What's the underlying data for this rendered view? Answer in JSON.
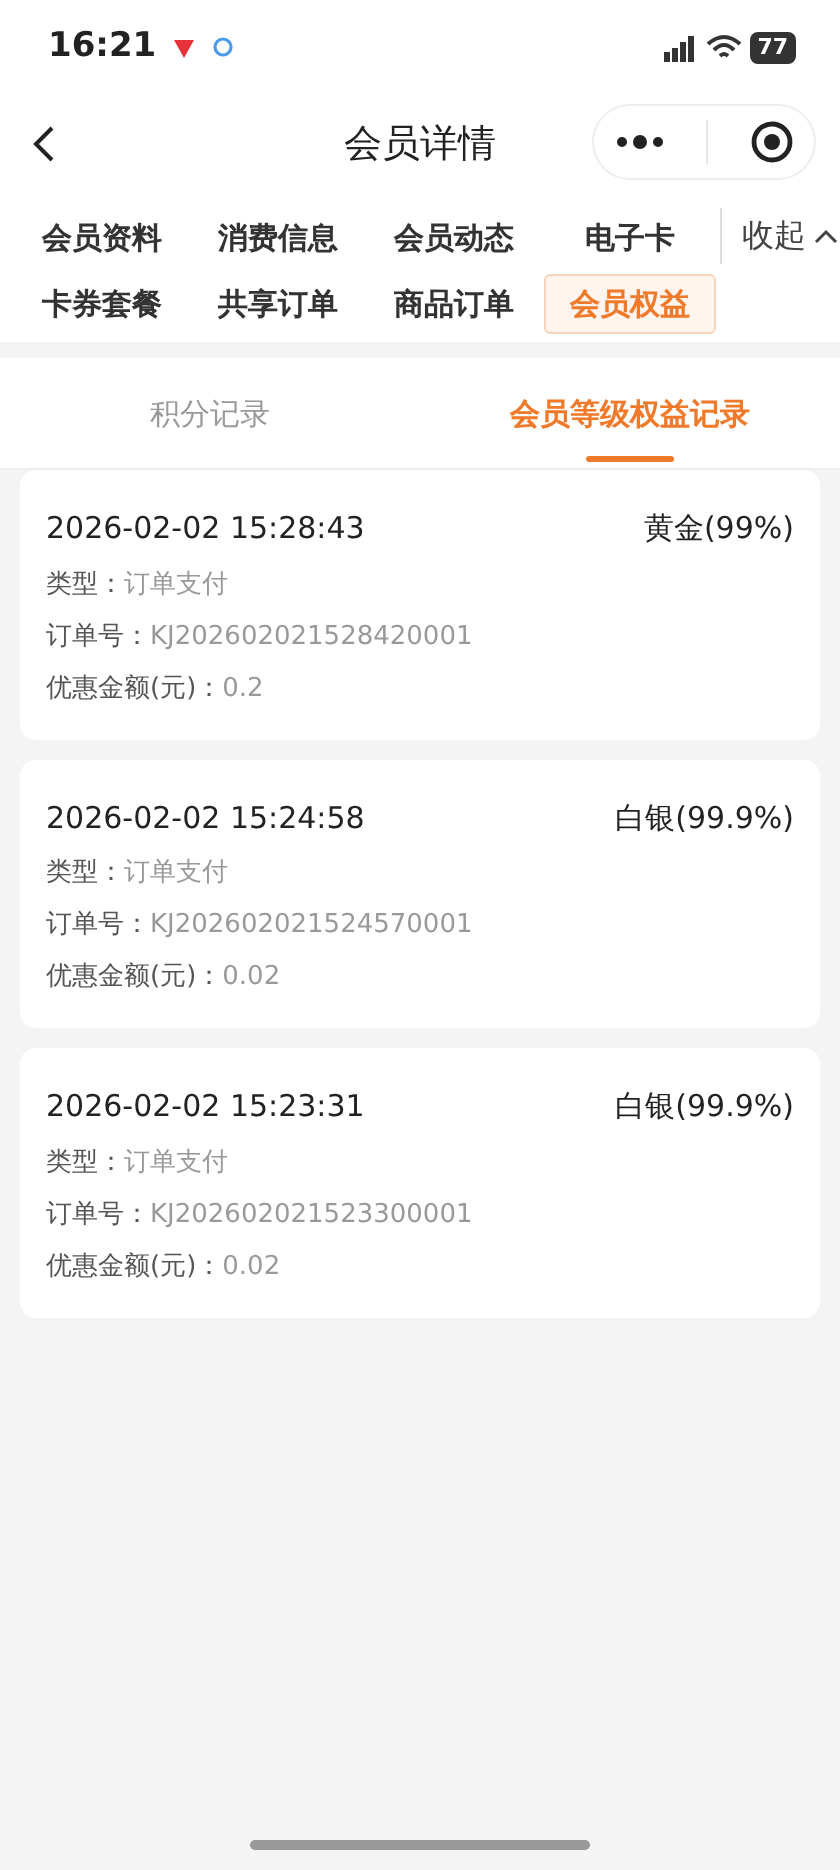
{
  "status_bar": {
    "time": "16:21",
    "battery": "77"
  },
  "header": {
    "title": "会员详情"
  },
  "menu_tabs": [
    {
      "label": "会员资料",
      "selected": false
    },
    {
      "label": "消费信息",
      "selected": false
    },
    {
      "label": "会员动态",
      "selected": false
    },
    {
      "label": "电子卡",
      "selected": false
    },
    {
      "label": "卡券套餐",
      "selected": false
    },
    {
      "label": "共享订单",
      "selected": false
    },
    {
      "label": "商品订单",
      "selected": false
    },
    {
      "label": "会员权益",
      "selected": true
    }
  ],
  "collapse": {
    "label": "收起"
  },
  "sub_tabs": [
    {
      "label": "积分记录",
      "selected": false
    },
    {
      "label": "会员等级权益记录",
      "selected": true
    }
  ],
  "records": [
    {
      "time": "2026-02-02 15:28:43",
      "level": "黄金(99%)",
      "fields": [
        {
          "label": "类型：",
          "value": "订单支付"
        },
        {
          "label": "订单号：",
          "value": "KJ202602021528420001"
        },
        {
          "label": "优惠金额(元)：",
          "value": "0.2"
        }
      ]
    },
    {
      "time": "2026-02-02 15:24:58",
      "level": "白银(99.9%)",
      "fields": [
        {
          "label": "类型：",
          "value": "订单支付"
        },
        {
          "label": "订单号：",
          "value": "KJ202602021524570001"
        },
        {
          "label": "优惠金额(元)：",
          "value": "0.02"
        }
      ]
    },
    {
      "time": "2026-02-02 15:23:31",
      "level": "白银(99.9%)",
      "fields": [
        {
          "label": "类型：",
          "value": "订单支付"
        },
        {
          "label": "订单号：",
          "value": "KJ202602021523300001"
        },
        {
          "label": "优惠金额(元)：",
          "value": "0.02"
        }
      ]
    }
  ]
}
